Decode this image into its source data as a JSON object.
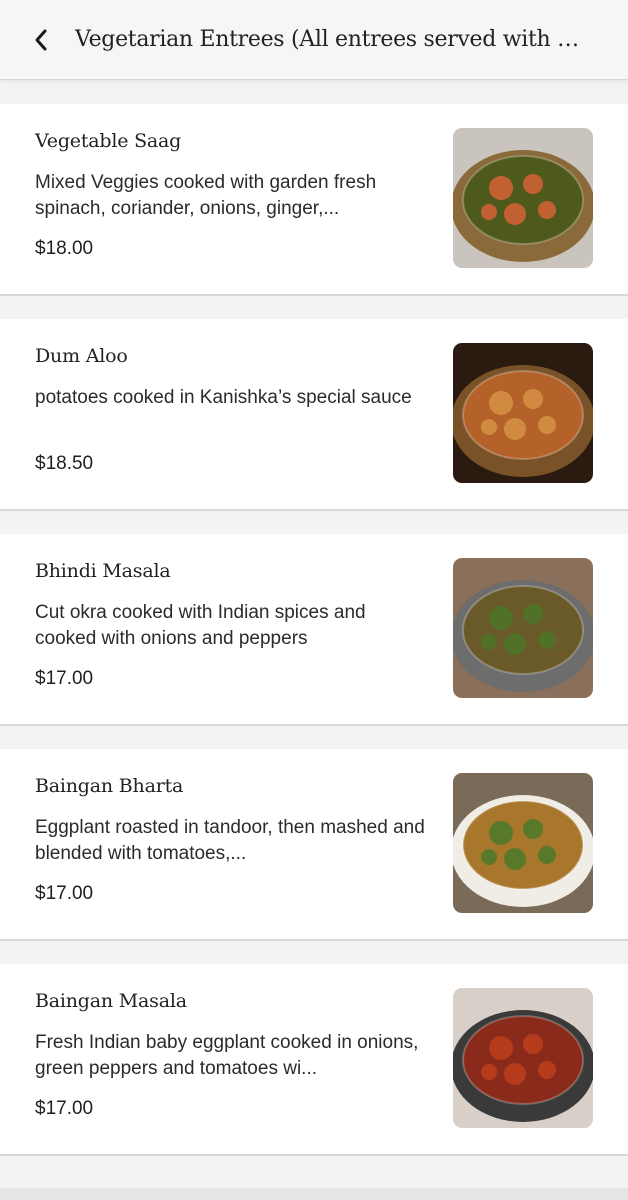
{
  "header": {
    "title": "Vegetarian Entrees (All entrees served with bas…",
    "back_icon": "chevron-left-icon"
  },
  "items": [
    {
      "name": "Vegetable Saag",
      "description": "Mixed Veggies cooked with garden fresh spinach, coriander, onions, ginger,...",
      "price": "$18.00",
      "photo": {
        "bg": "#c9c4bd",
        "bowl": "#8a6a3a",
        "food": "#4e5a1c",
        "accent": "#e8643a"
      }
    },
    {
      "name": "Dum Aloo",
      "description": "potatoes cooked in Kanishka’s special sauce",
      "price": "$18.50",
      "photo": {
        "bg": "#2a1a10",
        "bowl": "#7a5228",
        "food": "#b5622a",
        "accent": "#d99a4a"
      }
    },
    {
      "name": "Bhindi Masala",
      "description": "Cut okra cooked with Indian spices and cooked with onions and peppers",
      "price": "$17.00",
      "photo": {
        "bg": "#8a6f5a",
        "bowl": "#6d6d6d",
        "food": "#6a5a2a",
        "accent": "#4a7a2a"
      }
    },
    {
      "name": "Baingan Bharta",
      "description": "Eggplant roasted in tandoor, then mashed and blended with tomatoes,...",
      "price": "$17.00",
      "photo": {
        "bg": "#7a6a58",
        "bowl": "#f0ece6",
        "food": "#a8772c",
        "accent": "#3f7a2a"
      }
    },
    {
      "name": "Baingan Masala",
      "description": "Fresh Indian baby eggplant cooked in onions, green peppers and tomatoes wi...",
      "price": "$17.00",
      "photo": {
        "bg": "#d8d0c8",
        "bowl": "#3a3a3a",
        "food": "#8a2a1a",
        "accent": "#c4421e"
      }
    }
  ]
}
